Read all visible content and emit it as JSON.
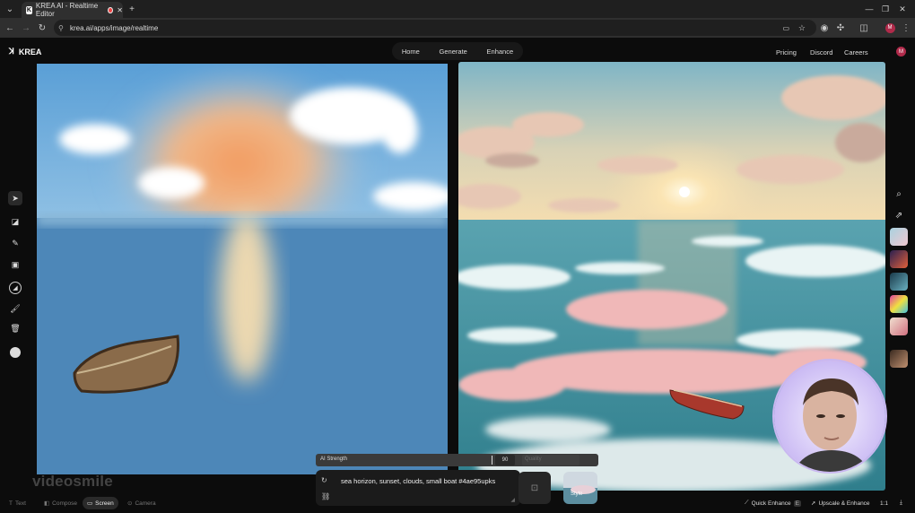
{
  "browser": {
    "tab_title": "KREA AI - Realtime Editor",
    "url": "krea.ai/apps/image/realtime",
    "profile_initial": "M"
  },
  "header": {
    "logo": "KREA",
    "nav": [
      "Home",
      "Generate",
      "Enhance"
    ],
    "right_links": [
      "Pricing",
      "Discord",
      "Careers"
    ],
    "avatar_initial": "M"
  },
  "toolbar": {
    "tools": [
      "select-icon",
      "eraser-icon",
      "pen-icon",
      "image-icon",
      "brush-size-icon",
      "paint-icon",
      "trash-icon",
      "webcam-icon"
    ]
  },
  "controls": {
    "strength_label": "AI Strength",
    "strength_value": "90",
    "quality_label": "Quality",
    "prompt": "sea horizon, sunset, clouds, small boat #4ae95upks",
    "style_label": "Style"
  },
  "bottom_tabs": [
    "Text",
    "Compose",
    "Screen",
    "Camera"
  ],
  "active_tab": "Screen",
  "bottom_right": {
    "quick_enhance": "Quick Enhance",
    "quick_enhance_badge": "E",
    "upscale": "Upscale & Enhance",
    "ratio": "1:1"
  },
  "watermark": "videosmile"
}
